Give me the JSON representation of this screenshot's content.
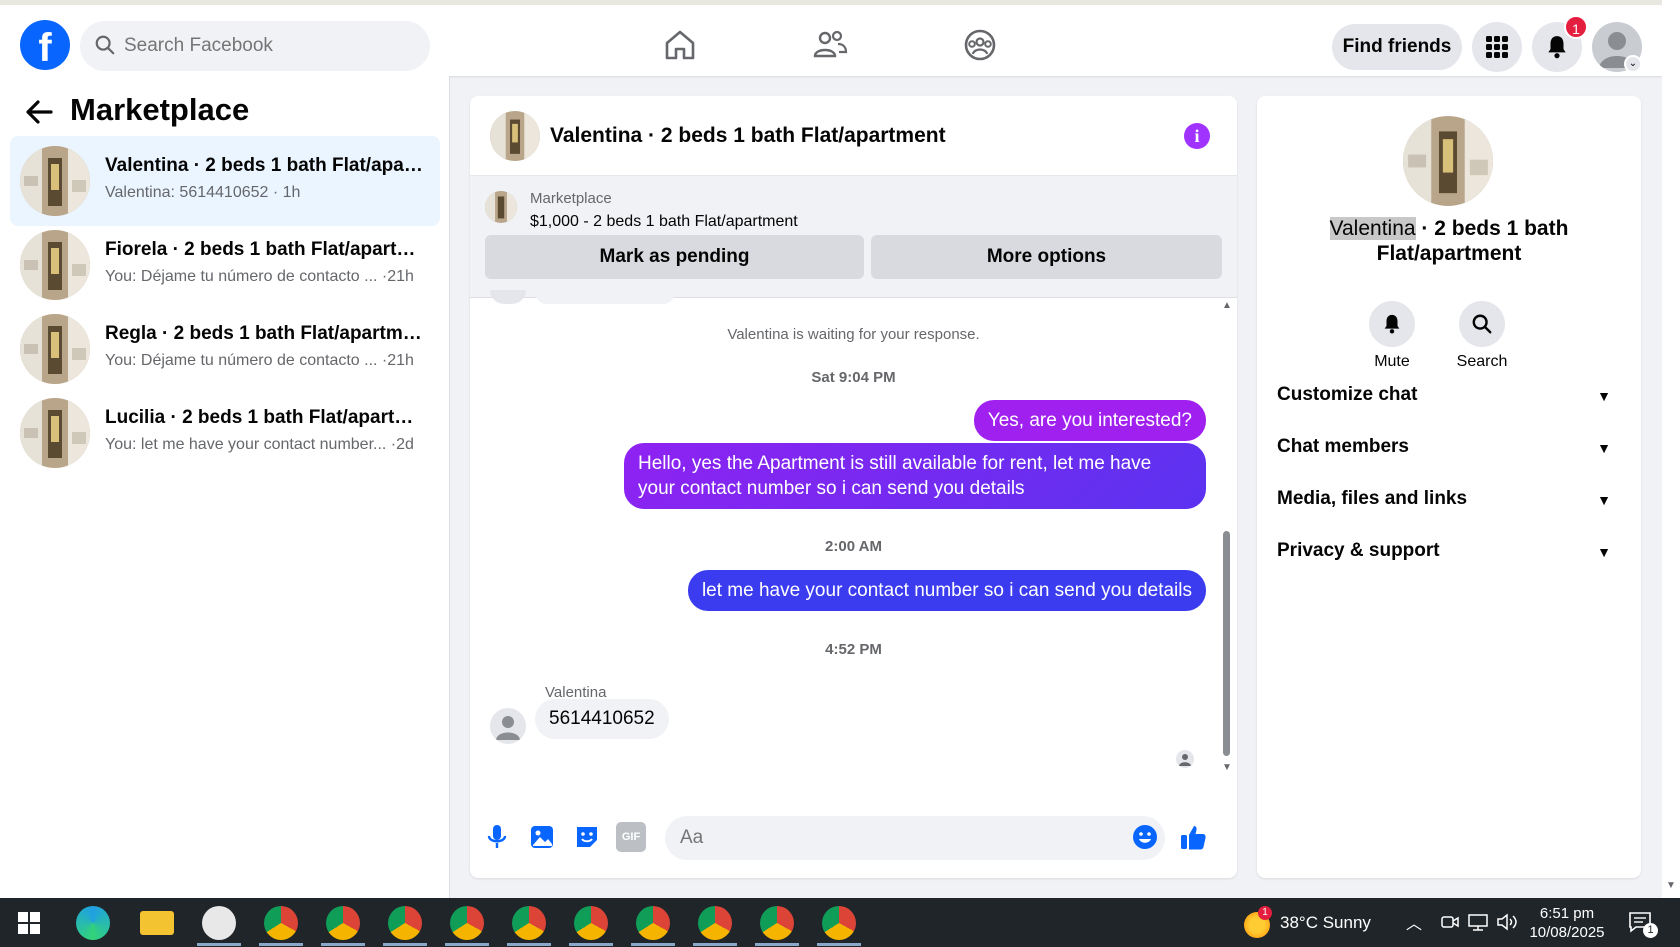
{
  "topbar": {
    "search_placeholder": "Search Facebook",
    "find_friends": "Find friends",
    "notification_count": "1"
  },
  "sidebar": {
    "title": "Marketplace",
    "conversations": [
      {
        "name": "Valentina · 2 beds 1 bath Flat/apar...",
        "preview": "Valentina: 5614410652 · 1h",
        "active": true
      },
      {
        "name": "Fiorela · 2 beds 1 bath Flat/apartm...",
        "preview": "You: Déjame tu número de contacto ... ·21h",
        "active": false
      },
      {
        "name": "Regla · 2 beds 1 bath Flat/apartment",
        "preview": "You: Déjame tu número de contacto ... ·21h",
        "active": false
      },
      {
        "name": "Lucilia · 2 beds 1 bath Flat/apartm...",
        "preview": "You: let me have your contact number... ·2d",
        "active": false
      }
    ]
  },
  "chat": {
    "title": "Valentina · 2 beds 1 bath Flat/apartment",
    "marketplace_label": "Marketplace",
    "listing": "$1,000 - 2 beds 1 bath Flat/apartment",
    "mark_pending": "Mark as pending",
    "more_options": "More options",
    "waiting_text": "Valentina is waiting for your response.",
    "messages": [
      {
        "type": "timestamp",
        "text": "Sat 9:04 PM"
      },
      {
        "type": "out",
        "text": "Yes, are you interested?"
      },
      {
        "type": "out",
        "text": "Hello, yes the Apartment is still available for rent, let me have your contact number so i can send you details"
      },
      {
        "type": "timestamp",
        "text": "2:00 AM"
      },
      {
        "type": "out",
        "text": "let me have your contact number so i can send you details"
      },
      {
        "type": "timestamp",
        "text": "4:52 PM"
      },
      {
        "type": "in",
        "sender": "Valentina",
        "text": "5614410652"
      }
    ],
    "composer_placeholder": "Aa",
    "gif_label": "GIF"
  },
  "right_panel": {
    "title_highlight": "Valentina",
    "title_rest": " · 2 beds 1 bath Flat/apartment",
    "actions": [
      {
        "label": "Mute",
        "icon": "bell-icon"
      },
      {
        "label": "Search",
        "icon": "search-icon"
      }
    ],
    "sections": [
      "Customize chat",
      "Chat members",
      "Media, files and links",
      "Privacy & support"
    ]
  },
  "taskbar": {
    "weather": "38°C  Sunny",
    "weather_badge": "1",
    "time": "6:51 pm",
    "date": "10/08/2025",
    "notif_count": "1"
  },
  "colors": {
    "brand": "#0866ff",
    "bubble_purple": "#a020f0",
    "bubble_blue": "#3b3bf0",
    "active_row": "#ebf5ff"
  }
}
